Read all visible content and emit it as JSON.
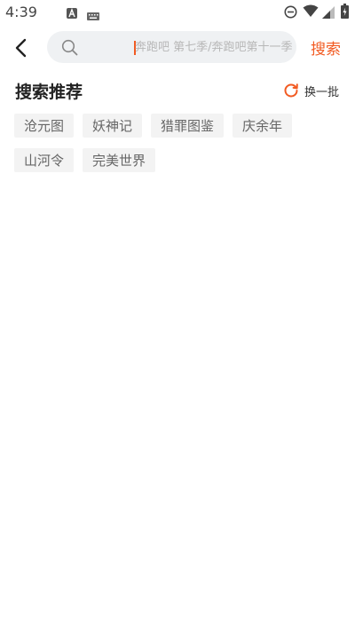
{
  "status_bar": {
    "time": "4:39"
  },
  "icons": {
    "back": "back-arrow-icon",
    "search": "search-icon",
    "refresh": "refresh-icon"
  },
  "colors": {
    "accent": "#f25b22",
    "tag_bg": "#f3f3f3",
    "search_bg": "#eff1f3"
  },
  "search": {
    "placeholder": "奔跑吧 第七季/奔跑吧第十一季",
    "value": "",
    "button_label": "搜索"
  },
  "recommend": {
    "title": "搜索推荐",
    "refresh_label": "换一批",
    "tags": [
      "沧元图",
      "妖神记",
      "猎罪图鉴",
      "庆余年",
      "山河令",
      "完美世界"
    ]
  }
}
